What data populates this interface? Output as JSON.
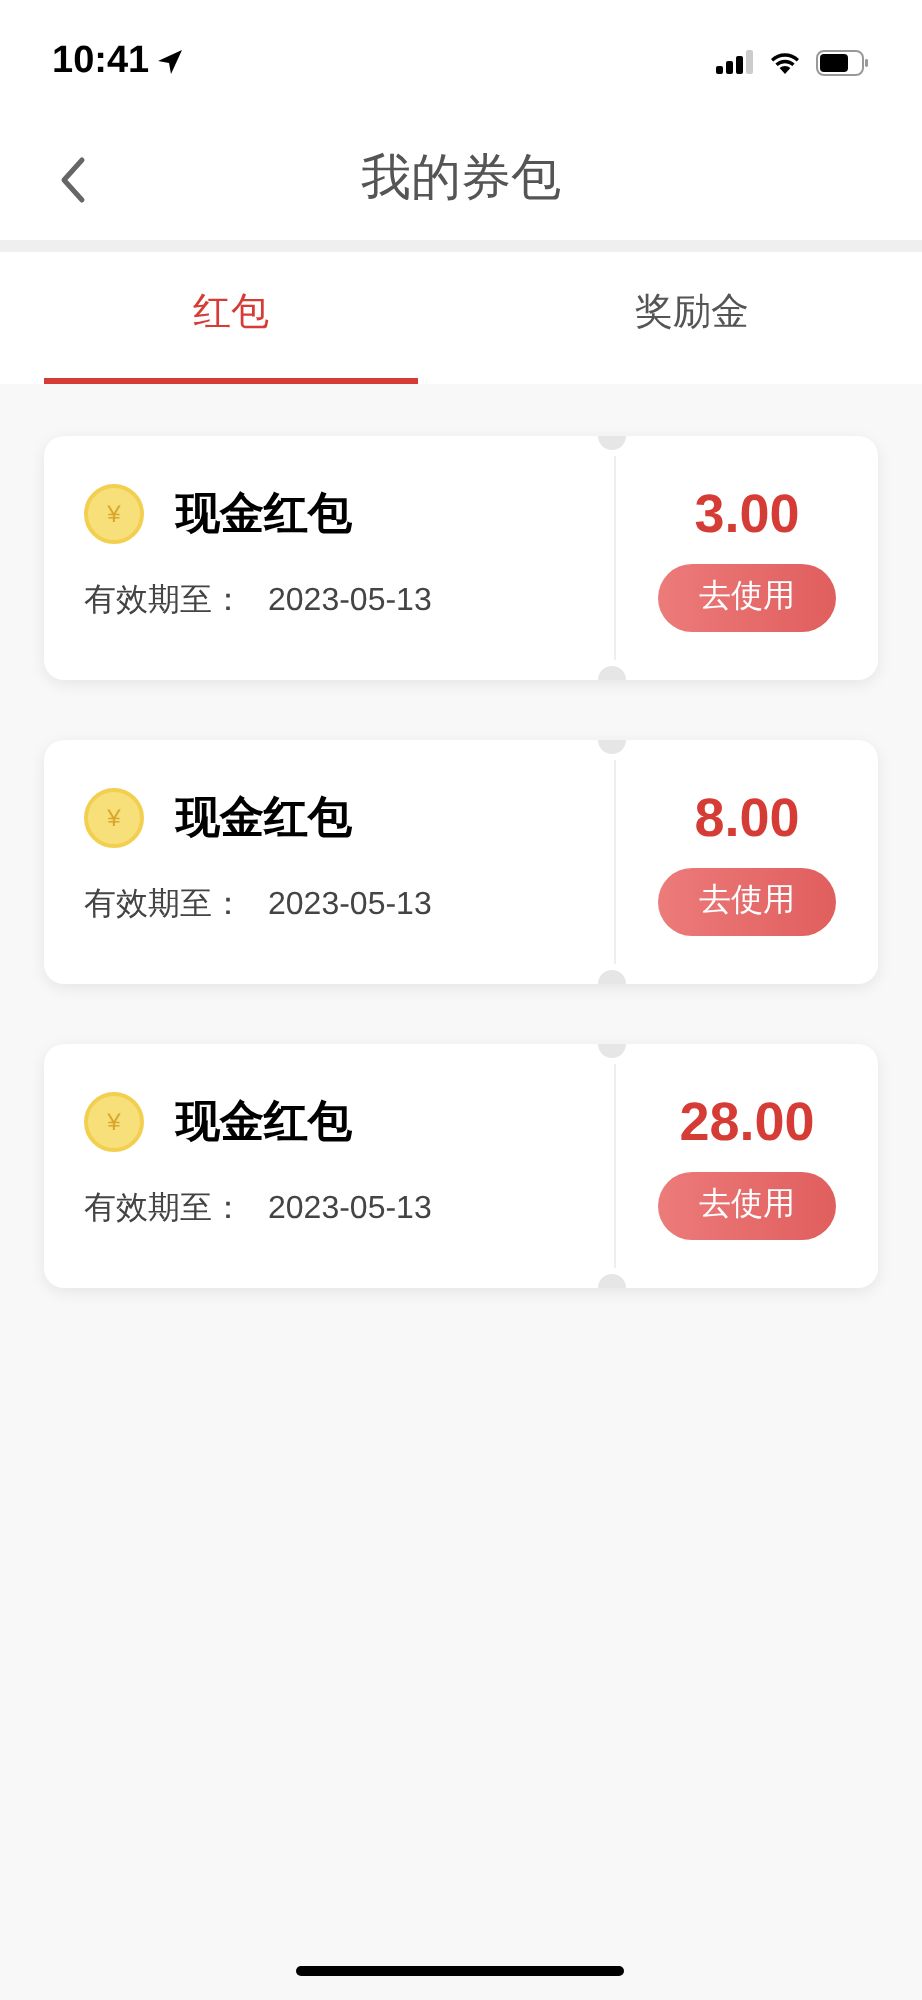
{
  "status_bar": {
    "time": "10:41"
  },
  "header": {
    "title": "我的券包"
  },
  "tabs": [
    {
      "label": "红包",
      "selected": true
    },
    {
      "label": "奖励金",
      "selected": false
    }
  ],
  "coupons": [
    {
      "coin_symbol": "¥",
      "title": "现金红包",
      "expiry_label": "有效期至：",
      "expiry_date": "2023-05-13",
      "amount": "3.00",
      "action": "去使用"
    },
    {
      "coin_symbol": "¥",
      "title": "现金红包",
      "expiry_label": "有效期至：",
      "expiry_date": "2023-05-13",
      "amount": "8.00",
      "action": "去使用"
    },
    {
      "coin_symbol": "¥",
      "title": "现金红包",
      "expiry_label": "有效期至：",
      "expiry_date": "2023-05-13",
      "amount": "28.00",
      "action": "去使用"
    }
  ]
}
